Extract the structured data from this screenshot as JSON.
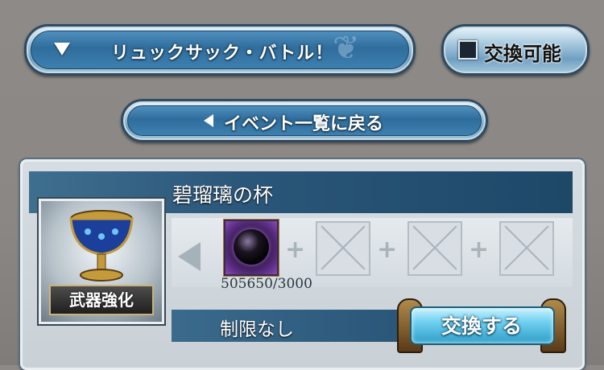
{
  "header": {
    "event_dropdown_label": "リュックサック・バトル！",
    "exchangeable_label": "交換可能",
    "back_label": "イベント一覧に戻る"
  },
  "item": {
    "name": "碧瑠璃の杯",
    "badge": "武器強化",
    "cost": {
      "owned_required": "505650/3000"
    },
    "limit": "制限なし",
    "exchange_button_label": "交換する"
  },
  "colors": {
    "button_blue": "#2f6d9c",
    "title_bar": "#2a5679",
    "exchange_button": "#6fcfef"
  }
}
